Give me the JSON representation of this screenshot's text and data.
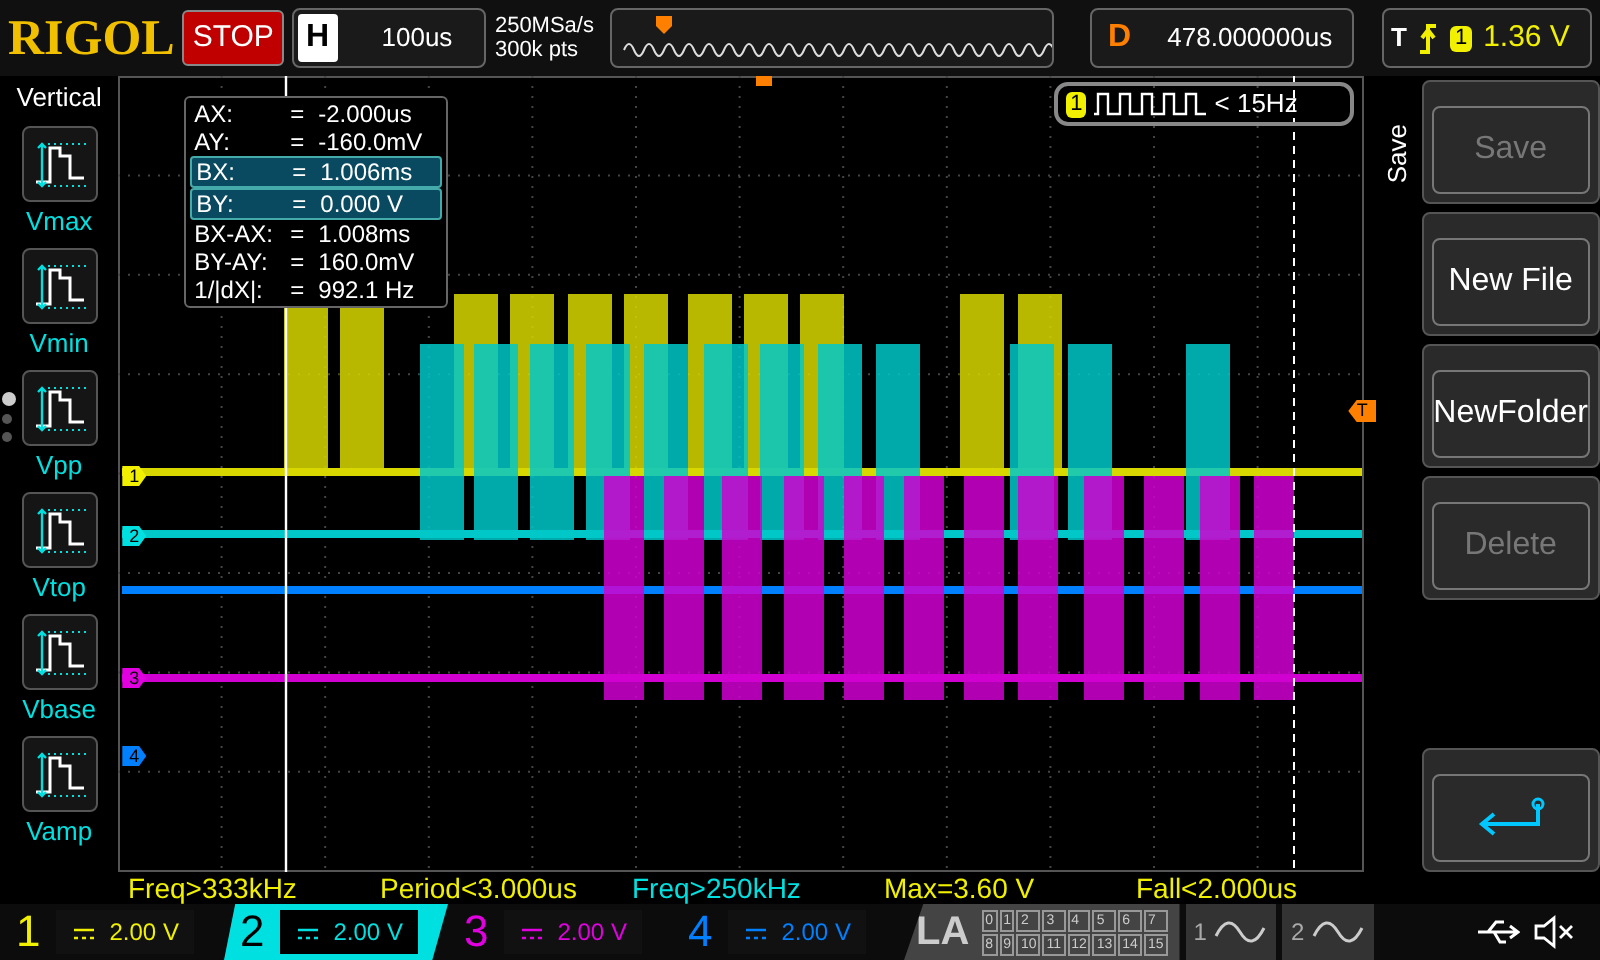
{
  "top_bar": {
    "logo": "RIGOL",
    "run_state": "STOP",
    "timebase": {
      "label": "H",
      "value": "100us"
    },
    "sample_rate": "250MSa/s",
    "memory_depth": "300k pts",
    "delay": {
      "label": "D",
      "value": "478.000000us"
    },
    "trigger": {
      "label": "T",
      "source": "1",
      "level": "1.36 V"
    }
  },
  "left_menu": {
    "title": "Vertical",
    "items": [
      {
        "label": "Vmax"
      },
      {
        "label": "Vmin"
      },
      {
        "label": "Vpp"
      },
      {
        "label": "Vtop"
      },
      {
        "label": "Vbase"
      },
      {
        "label": "Vamp"
      }
    ],
    "page_dots": [
      {
        "selected": true
      },
      {
        "selected": false
      },
      {
        "selected": false
      }
    ]
  },
  "cursor_readout": [
    {
      "name": "AX:",
      "equals": "=",
      "value": "-2.000us",
      "selected": false
    },
    {
      "name": "AY:",
      "equals": "=",
      "value": "-160.0mV",
      "selected": false
    },
    {
      "name": "BX:",
      "equals": "=",
      "value": "1.006ms",
      "selected": true
    },
    {
      "name": "BY:",
      "equals": "=",
      "value": "0.000 V",
      "selected": true
    },
    {
      "name": "BX-AX:",
      "equals": "=",
      "value": "1.008ms",
      "selected": false
    },
    {
      "name": "BY-AY:",
      "equals": "=",
      "value": "160.0mV",
      "selected": false
    },
    {
      "name": "1/|dX|:",
      "equals": "=",
      "value": "992.1 Hz",
      "selected": false
    }
  ],
  "frequency_counter": {
    "channel": "1",
    "value": "< 15Hz"
  },
  "channel_markers": [
    {
      "label": "1",
      "color": "#f0f000"
    },
    {
      "label": "2",
      "color": "#00e0e0"
    },
    {
      "label": "3",
      "color": "#e000e0"
    },
    {
      "label": "4",
      "color": "#0080ff"
    }
  ],
  "trigger_marker": {
    "label": "T"
  },
  "right_menu": {
    "title": "Save",
    "buttons": [
      {
        "kind": "text",
        "label": "Save",
        "disabled": true
      },
      {
        "kind": "text",
        "label": "New File",
        "disabled": false
      },
      {
        "kind": "text",
        "label": "NewFolder",
        "disabled": false
      },
      {
        "kind": "text",
        "label": "Delete",
        "disabled": true
      },
      {
        "kind": "return"
      }
    ]
  },
  "measurements": [
    {
      "text": "Freq>333kHz",
      "kind": "ch1"
    },
    {
      "text": "Period<3.000us",
      "kind": "ch1"
    },
    {
      "text": "Freq>250kHz",
      "kind": "ch2"
    },
    {
      "text": "Max=3.60 V",
      "kind": "ch1"
    },
    {
      "text": "Fall<2.000us",
      "kind": "ch1"
    }
  ],
  "channels": [
    {
      "number": "1",
      "scale": "2.00 V",
      "selected": false,
      "color": "#f0f000"
    },
    {
      "number": "2",
      "scale": "2.00 V",
      "selected": true,
      "color": "#00e0e0"
    },
    {
      "number": "3",
      "scale": "2.00 V",
      "selected": false,
      "color": "#e000e0"
    },
    {
      "number": "4",
      "scale": "2.00 V",
      "selected": false,
      "color": "#0080ff"
    }
  ],
  "logic_analyzer": {
    "label": "LA",
    "bits": [
      "0",
      "1",
      "2",
      "3",
      "4",
      "5",
      "6",
      "7",
      "8",
      "9",
      "10",
      "11",
      "12",
      "13",
      "14",
      "15"
    ]
  },
  "math_channels": [
    {
      "label": "1"
    },
    {
      "label": "2"
    }
  ]
}
